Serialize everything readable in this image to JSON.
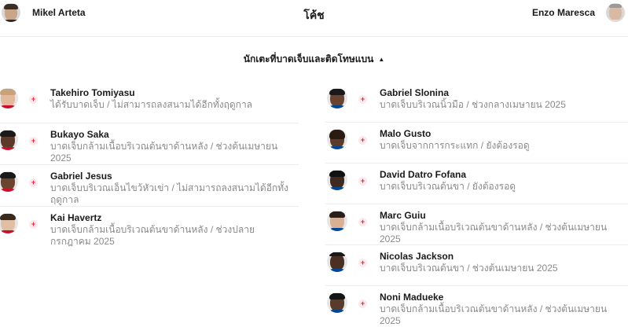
{
  "coaches": {
    "home_name": "Mikel Arteta",
    "title": "โค้ช",
    "away_name": "Enzo Maresca"
  },
  "section": {
    "title": "นักเตะที่บาดเจ็บและติดโทษแบน",
    "toggle_icon": "caret-up-icon"
  },
  "home_players": [
    {
      "name": "Takehiro Tomiyasu",
      "status": "ได้รับบาดเจ็บ / ไม่สามารถลงสนามได้อีกทั้งฤดูกาล"
    },
    {
      "name": "Bukayo Saka",
      "status": "บาดเจ็บกล้ามเนื้อบริเวณต้นขาด้านหลัง / ช่วงต้นเมษายน 2025"
    },
    {
      "name": "Gabriel Jesus",
      "status": "บาดเจ็บบริเวณเอ็นไขว้หัวเข่า / ไม่สามารถลงสนามได้อีกทั้งฤดูกาล"
    },
    {
      "name": "Kai Havertz",
      "status": "บาดเจ็บกล้ามเนื้อบริเวณต้นขาด้านหลัง / ช่วงปลายกรกฎาคม 2025"
    }
  ],
  "away_players": [
    {
      "name": "Gabriel Slonina",
      "status": "บาดเจ็บบริเวณนิ้วมือ / ช่วงกลางเมษายน 2025"
    },
    {
      "name": "Malo Gusto",
      "status": "บาดเจ็บจากการกระแทก / ยังต้องรอดู"
    },
    {
      "name": "David Datro Fofana",
      "status": "บาดเจ็บบริเวณต้นขา / ยังต้องรอดู"
    },
    {
      "name": "Marc Guiu",
      "status": "บาดเจ็บกล้ามเนื้อบริเวณต้นขาด้านหลัง / ช่วงต้นเมษายน 2025"
    },
    {
      "name": "Nicolas Jackson",
      "status": "บาดเจ็บบริเวณต้นขา / ช่วงต้นเมษายน 2025"
    },
    {
      "name": "Noni Madueke",
      "status": "บาดเจ็บกล้ามเนื้อบริเวณต้นขาด้านหลัง / ช่วงต้นเมษายน 2025"
    }
  ],
  "icons": {
    "injury": "injury-cross-icon",
    "avatar": "player-avatar"
  },
  "colors": {
    "injury_red": "#e0263a",
    "arsenal_red": "#c8102e",
    "chelsea_blue": "#034694",
    "muted_text": "#8a8a8a"
  }
}
